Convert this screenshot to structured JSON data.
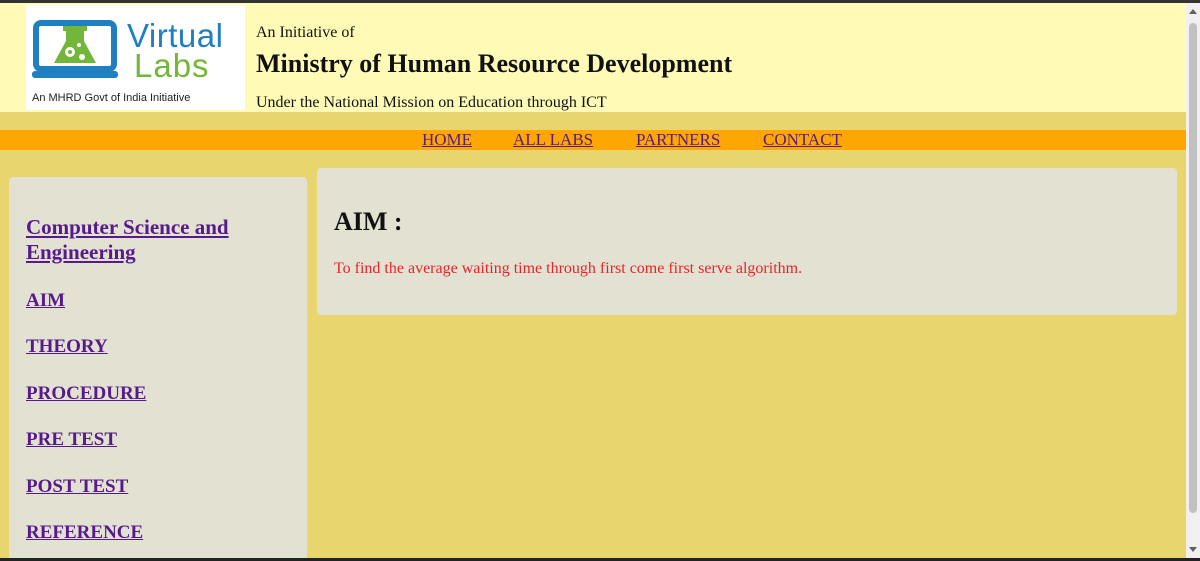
{
  "header": {
    "logo": {
      "word_virtual": "Virtual",
      "word_labs": "Labs",
      "tagline": "An MHRD Govt of India Initiative"
    },
    "initiative": "An Initiative of",
    "ministry": "Ministry of Human Resource Development",
    "mission": "Under the National Mission on Education through ICT"
  },
  "nav": {
    "home": "HOME",
    "all_labs": "ALL LABS",
    "partners": "PARTNERS",
    "contact": "CONTACT"
  },
  "sidebar": {
    "section": "Computer Science and Engineering",
    "items": [
      "AIM",
      "THEORY",
      "PROCEDURE",
      "PRE TEST",
      "POST TEST",
      "REFERENCE"
    ]
  },
  "content": {
    "title": "AIM :",
    "text": "To find the average waiting time through first come first serve algorithm."
  },
  "colors": {
    "page_bg": "#e8d56e",
    "header_bg": "#fffbb6",
    "nav_bg": "#ffa700",
    "panel_bg": "#e3e1d2",
    "link": "#551a8b",
    "aim_text": "#e8242b"
  }
}
